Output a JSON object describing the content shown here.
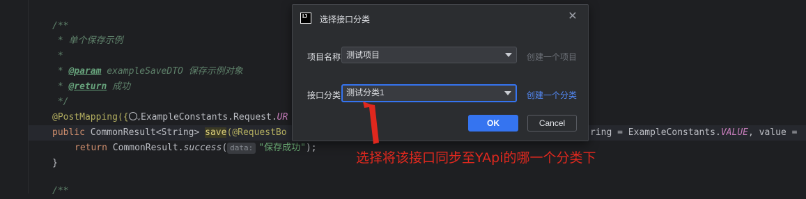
{
  "editor": {
    "lines": {
      "doc_open": "/**",
      "doc_summary": " * 单个保存示例",
      "doc_blank": " *",
      "doc_param_star": " * ",
      "doc_param_tag": "@param",
      "doc_param_text": " exampleSaveDTO 保存示例对象",
      "doc_return_star": " * ",
      "doc_return_tag": "@return",
      "doc_return_text": " 成功",
      "doc_close": " */",
      "ann_prefix": "@PostMapping({",
      "ann_rest": "ExampleConstants.Request.",
      "ann_italic": "UR",
      "sig_kw": "public",
      "sig_type": " CommonResult<String> ",
      "sig_method": "save",
      "sig_rest": "(@RequestBo",
      "sig_tail_a": "ring = ExampleConstants.",
      "sig_tail_italic": "VALUE",
      "sig_tail_b": ", value = ",
      "ret_kw": "return",
      "ret_class": " CommonResult.",
      "ret_method": "success",
      "ret_open": "(",
      "ret_hint": "data:",
      "ret_str": "\"保存成功\"",
      "ret_close": ");",
      "brace_close": "}",
      "next_doc": "/**"
    }
  },
  "dialog": {
    "title": "选择接口分类",
    "icon_text": "IJ",
    "project_label": "项目名称:",
    "project_value": "测试项目",
    "project_link": "创建一个项目",
    "category_label": "接口分类:",
    "category_value": "测试分类1",
    "category_link": "创建一个分类",
    "ok_label": "OK",
    "cancel_label": "Cancel"
  },
  "annotation": {
    "text": "选择将该接口同步至YApi的哪一个分类下",
    "color": "#e0281e"
  },
  "colors": {
    "editor_bg": "#1e1f22",
    "dialog_bg": "#2b2d30",
    "accent": "#3574f0",
    "link": "#548af7",
    "link_disabled": "#6f737a"
  }
}
